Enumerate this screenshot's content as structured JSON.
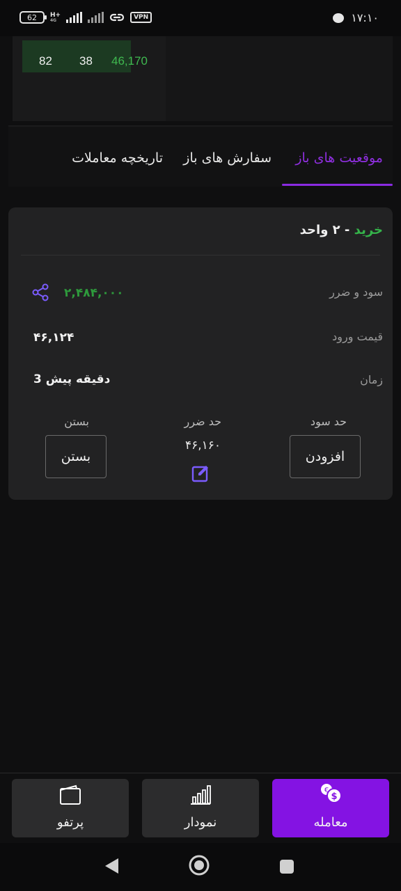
{
  "status_bar": {
    "battery": "62",
    "network": "H+",
    "network_sub": "4G",
    "vpn": "VPN",
    "time": "۱۷:۱۰"
  },
  "order_book": {
    "row": [
      "82",
      "38",
      "46,170"
    ]
  },
  "tabs": [
    {
      "label": "موقعیت های باز",
      "active": true
    },
    {
      "label": "سفارش های باز",
      "active": false
    },
    {
      "label": "تاریخچه معاملات",
      "active": false
    }
  ],
  "position": {
    "side": "خرید",
    "quantity_text": " - ۲ واحد",
    "pnl_label": "سود و ضرر",
    "pnl_value": "۲,۴۸۴,۰۰۰",
    "entry_label": "قیمت ورود",
    "entry_value": "۴۶,۱۲۴",
    "time_label": "زمان",
    "time_value": "3 دقیقه پیش",
    "take_profit_label": "حد سود",
    "take_profit_button": "افزودن",
    "stop_loss_label": "حد ضرر",
    "stop_loss_value": "۴۶,۱۶۰",
    "close_label": "بستن",
    "close_button": "بستن"
  },
  "bottom_nav": [
    {
      "label": "معامله",
      "icon": "coins-icon",
      "active": true
    },
    {
      "label": "نمودار",
      "icon": "bar-chart-icon",
      "active": false
    },
    {
      "label": "پرتفو",
      "icon": "wallet-icon",
      "active": false
    }
  ],
  "colors": {
    "accent": "#8413e3",
    "buy_green": "#35b34a",
    "pnl_green": "#2e9a3c",
    "card_bg": "#222223"
  }
}
